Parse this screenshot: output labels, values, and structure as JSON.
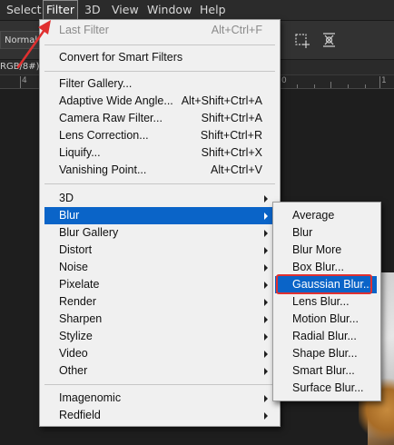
{
  "menubar": {
    "items": [
      {
        "label": "Select",
        "active": false
      },
      {
        "label": "Filter",
        "active": true
      },
      {
        "label": "3D",
        "active": false
      },
      {
        "label": "View",
        "active": false
      },
      {
        "label": "Window",
        "active": false
      },
      {
        "label": "Help",
        "active": false
      }
    ]
  },
  "options_bar": {
    "blend_mode": "Normal",
    "icons": [
      "transform-icon",
      "select-subject-icon"
    ]
  },
  "document": {
    "title_fragment": "RGB/8#)",
    "ruler_labels": [
      "4",
      "0",
      "1"
    ]
  },
  "filter_menu": {
    "last_filter": {
      "label": "Last Filter",
      "shortcut": "Alt+Ctrl+F"
    },
    "convert": {
      "label": "Convert for Smart Filters"
    },
    "group1": [
      {
        "label": "Filter Gallery...",
        "shortcut": ""
      },
      {
        "label": "Adaptive Wide Angle...",
        "shortcut": "Alt+Shift+Ctrl+A"
      },
      {
        "label": "Camera Raw Filter...",
        "shortcut": "Shift+Ctrl+A"
      },
      {
        "label": "Lens Correction...",
        "shortcut": "Shift+Ctrl+R"
      },
      {
        "label": "Liquify...",
        "shortcut": "Shift+Ctrl+X"
      },
      {
        "label": "Vanishing Point...",
        "shortcut": "Alt+Ctrl+V"
      }
    ],
    "group2": [
      "3D",
      "Blur",
      "Blur Gallery",
      "Distort",
      "Noise",
      "Pixelate",
      "Render",
      "Sharpen",
      "Stylize",
      "Video",
      "Other"
    ],
    "group3": [
      "Imagenomic",
      "Redfield"
    ],
    "selected": "Blur"
  },
  "blur_submenu": {
    "items": [
      "Average",
      "Blur",
      "Blur More",
      "Box Blur...",
      "Gaussian Blur...",
      "Lens Blur...",
      "Motion Blur...",
      "Radial Blur...",
      "Shape Blur...",
      "Smart Blur...",
      "Surface Blur..."
    ],
    "selected": "Gaussian Blur...",
    "highlight_color": "#e03030"
  },
  "colors": {
    "selection": "#0a64c8",
    "annotation": "#e03030"
  }
}
